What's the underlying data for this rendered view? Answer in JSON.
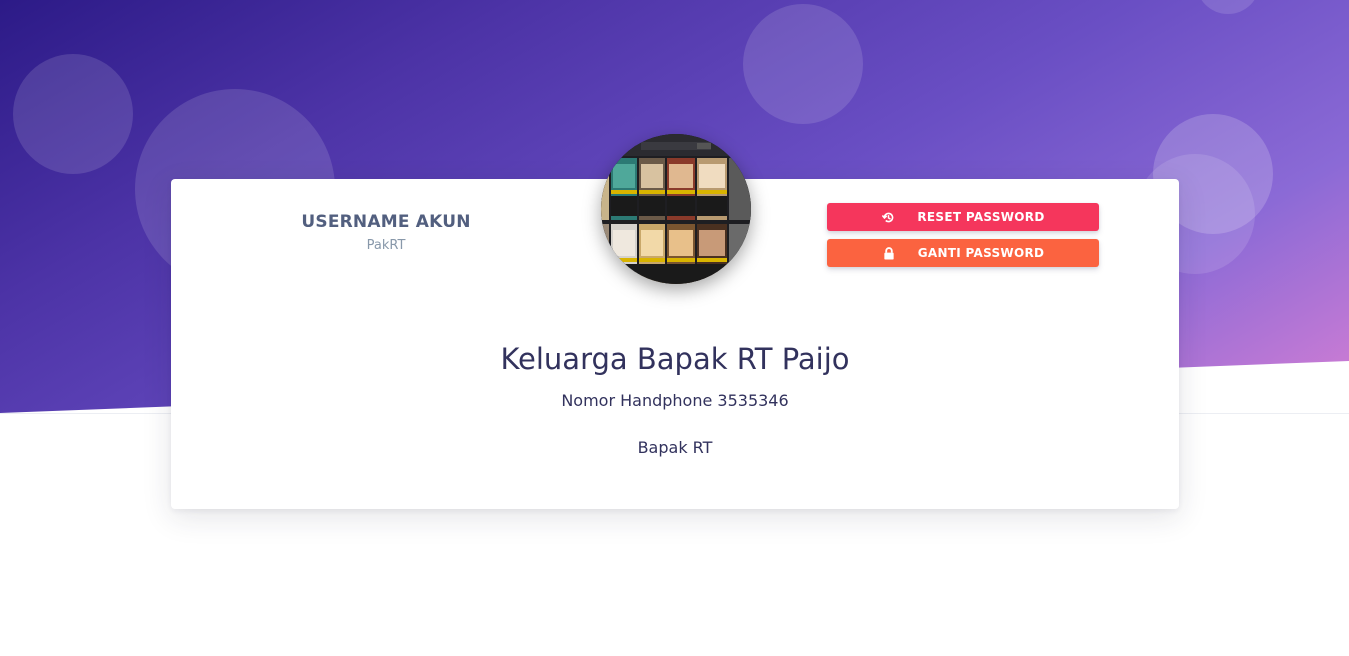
{
  "profile": {
    "username_label": "USERNAME AKUN",
    "username_value": "PakRT",
    "full_name": "Keluarga Bapak RT Paijo",
    "phone_label": "Nomor Handphone",
    "phone_number": "3535346",
    "role": "Bapak RT"
  },
  "actions": {
    "reset_password_label": "RESET PASSWORD",
    "reset_password_icon": "history-icon",
    "ganti_password_label": "GANTI PASSWORD",
    "ganti_password_icon": "lock-icon"
  },
  "colors": {
    "reset_button": "#f5365c",
    "ganti_button": "#fb6340",
    "hero_gradient_start": "#2c1a87",
    "hero_gradient_end": "#d77fd4",
    "heading_text": "#32325d",
    "label_text": "#525f7f",
    "muted_text": "#8898aa"
  }
}
